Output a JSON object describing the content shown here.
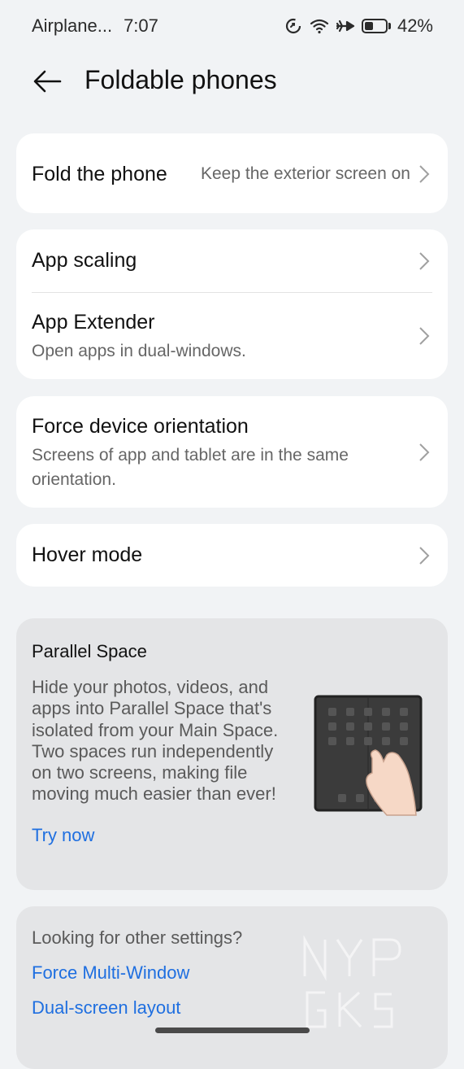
{
  "status": {
    "mode": "Airplane...",
    "time": "7:07",
    "battery": "42%",
    "battery_level": 0.42
  },
  "header": {
    "title": "Foldable phones"
  },
  "fold": {
    "title": "Fold the phone",
    "value": "Keep the exterior screen on"
  },
  "app_group": {
    "scaling": {
      "title": "App scaling"
    },
    "extender": {
      "title": "App Extender",
      "subtitle": "Open apps in dual-windows."
    }
  },
  "orientation": {
    "title": "Force device orientation",
    "subtitle": "Screens of app and tablet are in the same orientation."
  },
  "hover": {
    "title": "Hover mode"
  },
  "parallel": {
    "title": "Parallel Space",
    "body": "Hide your photos, videos, and apps into Parallel Space that's isolated from your Main Space. Two spaces run independently on two screens, making file moving much easier than ever!",
    "cta": "Try now"
  },
  "other": {
    "title": "Looking for other settings?",
    "links": [
      "Force Multi-Window",
      "Dual-screen layout"
    ]
  },
  "colors": {
    "accent": "#1f6fe0",
    "background": "#f1f3f5",
    "card": "#ffffff"
  },
  "icons": [
    "data-saver-icon",
    "wifi-icon",
    "airplane-icon",
    "battery-icon",
    "back-arrow-icon",
    "chevron-right-icon"
  ]
}
